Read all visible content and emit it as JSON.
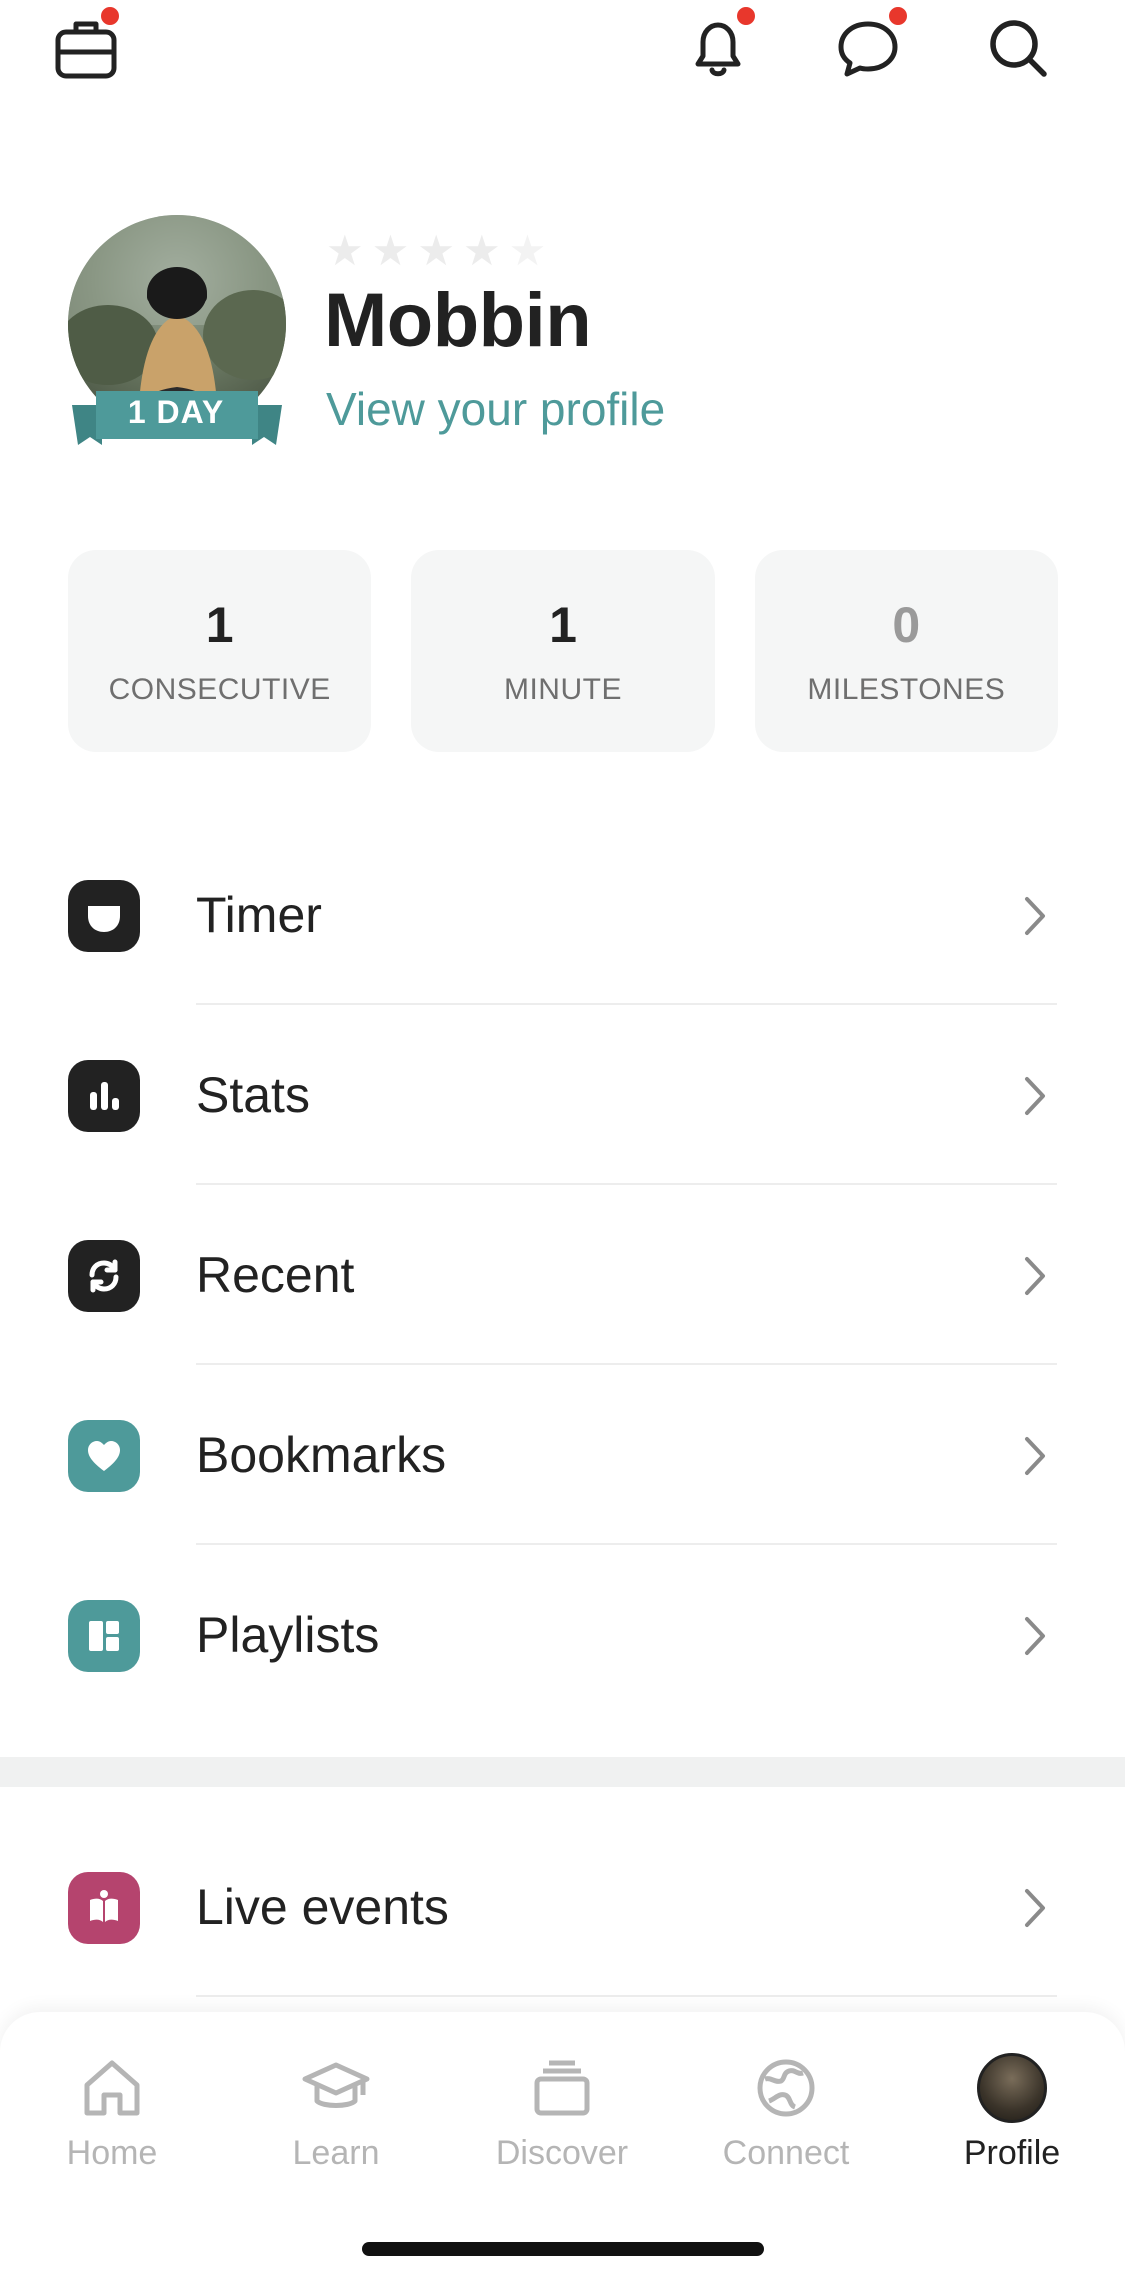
{
  "top_bar": {
    "icons": [
      "briefcase-icon",
      "bell-icon",
      "chat-bubble-icon",
      "search-icon"
    ],
    "notification_color": "#e8372c"
  },
  "profile": {
    "name": "Mobbin",
    "view_link": "View your profile",
    "streak_badge": "1 DAY",
    "star_rating": 0,
    "stars_total": 5,
    "accent_color": "#4e9a9a"
  },
  "stats": [
    {
      "value": "1",
      "label": "CONSECUTIVE"
    },
    {
      "value": "1",
      "label": "MINUTE"
    },
    {
      "value": "0",
      "label": "MILESTONES"
    }
  ],
  "menu": [
    {
      "label": "Timer",
      "icon": "timer-icon",
      "icon_color": "#222222"
    },
    {
      "label": "Stats",
      "icon": "bar-chart-icon",
      "icon_color": "#222222"
    },
    {
      "label": "Recent",
      "icon": "refresh-icon",
      "icon_color": "#222222"
    },
    {
      "label": "Bookmarks",
      "icon": "heart-icon",
      "icon_color": "#4e9a9a"
    },
    {
      "label": "Playlists",
      "icon": "playlist-grid-icon",
      "icon_color": "#4e9a9a"
    }
  ],
  "secondary_menu": [
    {
      "label": "Live events",
      "icon": "live-events-icon",
      "icon_color": "#b5446e"
    }
  ],
  "tab_bar": {
    "tabs": [
      {
        "label": "Home",
        "icon": "home-icon",
        "active": false
      },
      {
        "label": "Learn",
        "icon": "graduation-cap-icon",
        "active": false
      },
      {
        "label": "Discover",
        "icon": "stack-icon",
        "active": false
      },
      {
        "label": "Connect",
        "icon": "globe-icon",
        "active": false
      },
      {
        "label": "Profile",
        "icon": "profile-avatar-icon",
        "active": true
      }
    ]
  }
}
